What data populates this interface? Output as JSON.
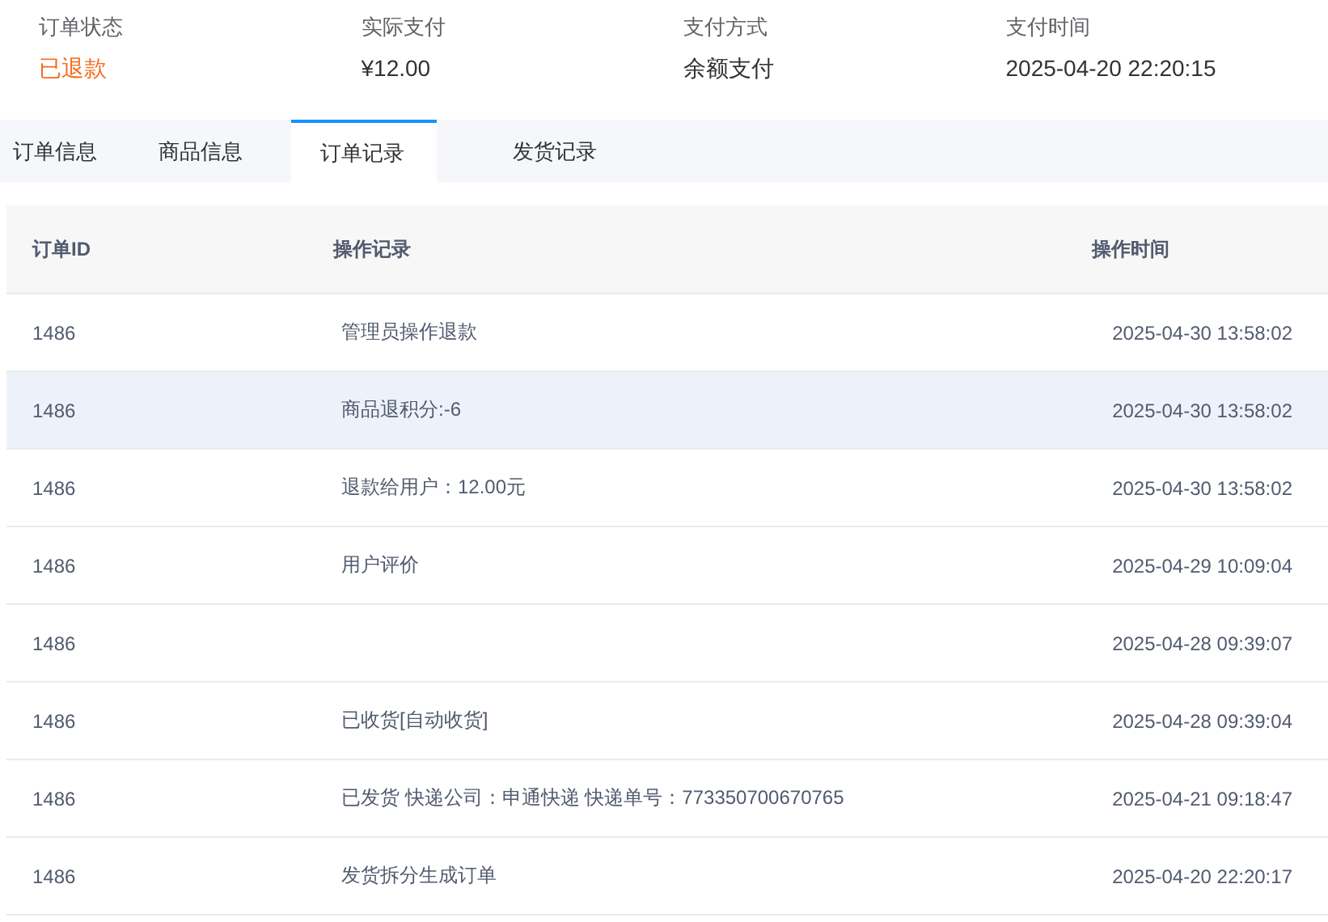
{
  "summary": [
    {
      "label": "订单状态",
      "value": "已退款",
      "kind": "status"
    },
    {
      "label": "实际支付",
      "value": "¥12.00",
      "kind": "plain"
    },
    {
      "label": "支付方式",
      "value": "余额支付",
      "kind": "plain"
    },
    {
      "label": "支付时间",
      "value": "2025-04-20 22:20:15",
      "kind": "plain"
    }
  ],
  "tabs": [
    {
      "label": "订单信息",
      "selected": false
    },
    {
      "label": "商品信息",
      "selected": false
    },
    {
      "label": "订单记录",
      "selected": true
    },
    {
      "label": "发货记录",
      "selected": false
    }
  ],
  "table": {
    "columns": [
      "订单ID",
      "操作记录",
      "操作时间"
    ],
    "rows": [
      {
        "id": "1486",
        "record": "管理员操作退款",
        "time": "2025-04-30 13:58:02",
        "highlighted": false
      },
      {
        "id": "1486",
        "record": "商品退积分:-6",
        "time": "2025-04-30 13:58:02",
        "highlighted": true
      },
      {
        "id": "1486",
        "record": "退款给用户：12.00元",
        "time": "2025-04-30 13:58:02",
        "highlighted": false
      },
      {
        "id": "1486",
        "record": "用户评价",
        "time": "2025-04-29 10:09:04",
        "highlighted": false
      },
      {
        "id": "1486",
        "time": "2025-04-28 09:39:07",
        "highlighted": false
      },
      {
        "id": "1486",
        "record": "已收货[自动收货]",
        "time": "2025-04-28 09:39:04",
        "highlighted": false
      },
      {
        "id": "1486",
        "record": "已发货 快递公司：申通快递 快递单号：773350700670765",
        "time": "2025-04-21 09:18:47",
        "highlighted": false
      },
      {
        "id": "1486",
        "record": "发货拆分生成订单",
        "time": "2025-04-20 22:20:17",
        "highlighted": false
      }
    ]
  }
}
